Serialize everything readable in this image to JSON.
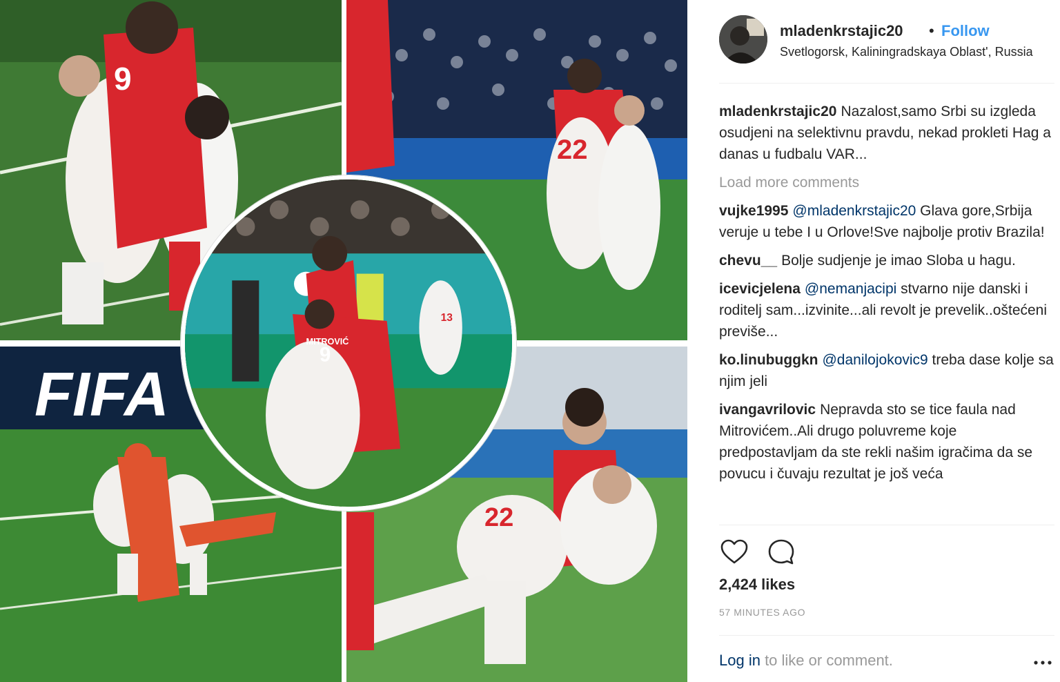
{
  "post": {
    "author": "mladenkrstajic20",
    "separator": "•",
    "follow_label": "Follow",
    "location": "Svetlogorsk, Kaliningradskaya Oblast', Russia",
    "avatar_icon": "avatar-photo"
  },
  "caption": {
    "user": "mladenkrstajic20",
    "text": "Nazalost,samo Srbi su izgleda osudjeni na selektivnu pravdu, nekad prokleti Hag a danas u fudbalu VAR..."
  },
  "load_more": "Load more comments",
  "comments": [
    {
      "user": "vujke1995",
      "mention": "@mladenkrstajic20",
      "text": " Glava gore,Srbija veruje u tebe I u Orlove!Sve najbolje protiv Brazila!"
    },
    {
      "user": "chevu__",
      "mention": "",
      "text": "Bolje sudjenje je imao Sloba u hagu."
    },
    {
      "user": "icevicjelena",
      "mention": "@nemanjacipi",
      "text": " stvarno nije danski i roditelj sam...izvinite...ali revolt je prevelik..oštećeni previše..."
    },
    {
      "user": "ko.linubuggkn",
      "mention": "@danilojokovic9",
      "text": " treba dase kolje sa njim jeli"
    },
    {
      "user": "ivangavrilovic",
      "mention": "",
      "text": "Nepravda sto se tice faula nad Mitrovićem..Ali drugo poluvreme koje predpostavljam da ste rekli našim igračima da se povucu i čuvaju rezultat je još veća"
    }
  ],
  "actions": {
    "like_icon": "heart-icon",
    "comment_icon": "comment-bubble-icon"
  },
  "likes": "2,424 likes",
  "time": "57 MINUTES AGO",
  "footer": {
    "login": "Log in",
    "rest": " to like or comment.",
    "more_icon": "ellipsis-icon"
  },
  "photo": {
    "banner_text": "FIFA",
    "center_name": "MITROVIĆ",
    "jersey_numbers": [
      "9",
      "22",
      "13",
      "9",
      "22"
    ]
  },
  "colors": {
    "link": "#003569",
    "follow": "#3897f0",
    "muted": "#999999",
    "serbia_red": "#d8262d",
    "pitch": "#4f8f3c"
  }
}
